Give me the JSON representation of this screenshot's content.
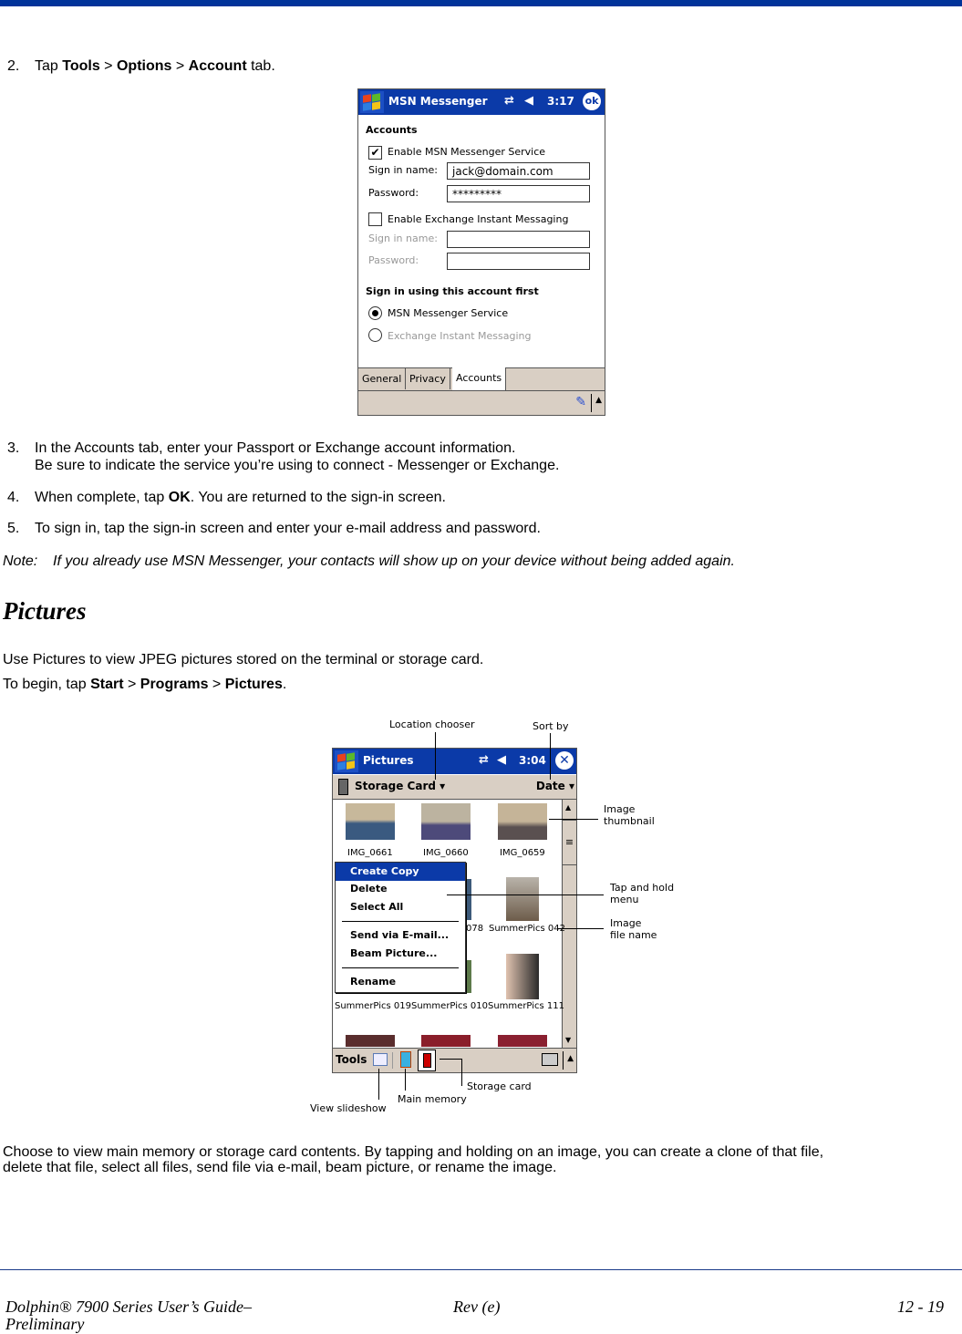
{
  "step2": {
    "num": "2.",
    "pre": "Tap ",
    "b1": "Tools",
    "sep1": " > ",
    "b2": "Options",
    "sep2": " > ",
    "b3": "Account",
    "post": " tab."
  },
  "msn_screen": {
    "title": "MSN Messenger",
    "time": "3:17",
    "ok_label": "ok",
    "section1": "Accounts",
    "enable_msn_label": "Enable MSN Messenger Service",
    "enable_msn_checked": true,
    "msn_signin_label": "Sign in name:",
    "msn_signin_value": "jack@domain.com",
    "msn_password_label": "Password:",
    "msn_password_value": "*********",
    "enable_exchange_label": "Enable Exchange Instant Messaging",
    "enable_exchange_checked": false,
    "ex_signin_label": "Sign in name:",
    "ex_signin_value": "",
    "ex_password_label": "Password:",
    "ex_password_value": "",
    "section2": "Sign in using this account first",
    "radio_msn": "MSN Messenger Service",
    "radio_exchange": "Exchange Instant Messaging",
    "selected_radio": "MSN Messenger Service",
    "tabs": [
      "General",
      "Privacy",
      "Accounts"
    ],
    "active_tab": "Accounts"
  },
  "step3": {
    "num": "3.",
    "line1": "In the Accounts tab, enter your Passport or Exchange account information.",
    "line2": "Be sure to indicate the service you’re using to connect - Messenger or Exchange."
  },
  "step4": {
    "num": "4.",
    "pre": "When complete, tap ",
    "b": "OK",
    "post": ". You are returned to the sign-in screen."
  },
  "step5": {
    "num": "5.",
    "text": "To sign in, tap the sign-in screen and enter your e-mail address and password."
  },
  "note": {
    "label": "Note:",
    "text": "If you already use MSN Messenger, your contacts will show up on your device without being added again."
  },
  "pictures_heading": "Pictures",
  "pictures_intro": "Use Pictures to view JPEG pictures stored on the terminal or storage card.",
  "begin": {
    "pre": "To begin, tap ",
    "b1": "Start",
    "sep1": " > ",
    "b2": "Programs",
    "sep2": " > ",
    "b3": "Pictures",
    "post": "."
  },
  "pictures_screen": {
    "title": "Pictures",
    "time": "3:04",
    "location": "Storage Card",
    "sort": "Date",
    "row1": [
      "IMG_0661",
      "IMG_0660",
      "IMG_0659"
    ],
    "row2": [
      "078",
      "SummerPics 042"
    ],
    "row3": [
      "SummerPics 019",
      "SummerPics 010",
      "SummerPics 111"
    ],
    "menu": [
      "Create Copy",
      "Delete",
      "Select All",
      "Send via E-mail...",
      "Beam Picture...",
      "Rename"
    ],
    "menu_selected": "Create Copy",
    "tools_label": "Tools"
  },
  "callouts": {
    "location_chooser": "Location chooser",
    "sort_by": "Sort by",
    "image_thumbnail_1": "Image",
    "image_thumbnail_2": "thumbnail",
    "tap_hold_1": "Tap and hold",
    "tap_hold_2": "menu",
    "file_name_1": "Image",
    "file_name_2": "file name",
    "storage_card": "Storage card",
    "main_memory": "Main memory",
    "view_slideshow": "View slideshow"
  },
  "closing": {
    "line1": "Choose to view main memory or storage card contents. By tapping and holding on an image, you can create a clone of that file,",
    "line2": "delete that file, select all files, send file via e-mail, beam picture, or rename the image."
  },
  "footer": {
    "left1": "Dolphin® 7900 Series User’s Guide–",
    "left2": "Preliminary",
    "center": "Rev (e)",
    "right": "12 - 19"
  }
}
